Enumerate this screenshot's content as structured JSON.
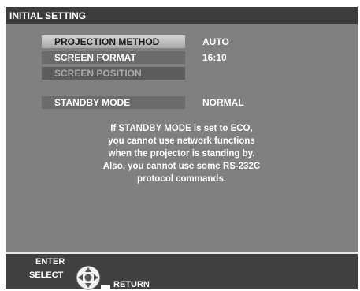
{
  "title": "INITIAL SETTING",
  "menu": [
    {
      "label": "PROJECTION METHOD",
      "value": "AUTO"
    },
    {
      "label": "SCREEN FORMAT",
      "value": "16:10"
    },
    {
      "label": "SCREEN POSITION",
      "value": ""
    },
    {
      "label": "STANDBY MODE",
      "value": "NORMAL"
    }
  ],
  "notice": [
    "If STANDBY MODE is set to ECO,",
    "you cannot use network functions",
    "when the projector is standing by.",
    "Also, you cannot use some RS-232C",
    "protocol commands."
  ],
  "footer": {
    "enter": "ENTER",
    "select": "SELECT",
    "return": "RETURN"
  },
  "icons": {
    "dpad": "dpad-icon",
    "return": "return-key-icon"
  }
}
